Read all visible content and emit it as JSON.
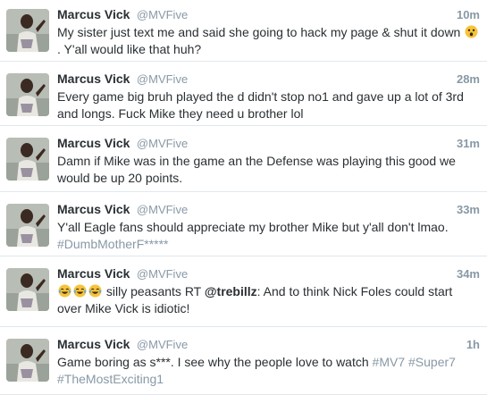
{
  "colors": {
    "name": "#292f33",
    "muted": "#8899a6",
    "divider": "#e1e8ed",
    "emoji_face": "#f6c33a"
  },
  "tweets": [
    {
      "name": "Marcus Vick",
      "handle": "@MVFive",
      "time": "10m",
      "text_before": "My sister just text me and said she going to hack my page & shut it down",
      "emoji_after": "astonished-face-emoji",
      "text_after": ". Y'all would like that huh?"
    },
    {
      "name": "Marcus Vick",
      "handle": "@MVFive",
      "time": "28m",
      "text": "Every game big bruh played the d didn't stop no1 and gave up a lot of 3rd and longs. Fuck Mike they need u brother lol"
    },
    {
      "name": "Marcus Vick",
      "handle": "@MVFive",
      "time": "31m",
      "text": "Damn if Mike was in the game an the Defense was playing this good we would be up 20 points."
    },
    {
      "name": "Marcus Vick",
      "handle": "@MVFive",
      "time": "33m",
      "text": "Y'all Eagle fans should appreciate my brother Mike but y'all don't lmao.",
      "hashtag": "#DumbMotherF*****"
    },
    {
      "name": "Marcus Vick",
      "handle": "@MVFive",
      "time": "34m",
      "emojis": [
        "crying-laughing-emoji",
        "crying-laughing-emoji",
        "crying-laughing-emoji"
      ],
      "text_pre": "silly peasants RT",
      "mention": "@trebillz",
      "text_post": ": And to think Nick Foles could start over Mike Vick is idiotic!"
    },
    {
      "name": "Marcus Vick",
      "handle": "@MVFive",
      "time": "1h",
      "text": "Game boring as s***. I see why the people love to watch",
      "hashtag1": "#MV7",
      "hashtag2": "#Super7",
      "hashtag3": "#TheMostExciting1"
    }
  ]
}
